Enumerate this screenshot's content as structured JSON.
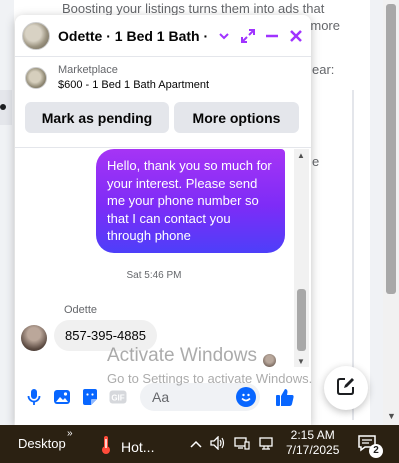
{
  "background": {
    "line1": "Boosting your listings turns them into ads that",
    "line2": "more",
    "edge_right_1": "ear:",
    "edge_right_2": "e"
  },
  "chat": {
    "title": "Odette · 1 Bed 1 Bath ·",
    "marketplace_label": "Marketplace",
    "listing": "$600 - 1 Bed 1 Bath Apartment",
    "mark_pending_label": "Mark as pending",
    "more_options_label": "More options",
    "outgoing_message": "Hello, thank you so much for your interest. Please send me your phone number so that I can contact you through phone",
    "timestamp": "Sat 5:46 PM",
    "sender_name": "Odette",
    "incoming_message": "857-395-4885",
    "composer_placeholder": "Aa"
  },
  "watermark": {
    "line1": "Activate Windows",
    "line2": "Go to Settings to activate Windows."
  },
  "taskbar": {
    "desktop_label": "Desktop",
    "weather_label": "Hot...",
    "time": "2:15 AM",
    "date": "7/17/2025",
    "notification_count": "2"
  },
  "colors": {
    "accent": "#a033ff",
    "bubble_gradient_start": "#a634f5",
    "bubble_gradient_end": "#4d3ff9",
    "messenger_blue": "#0866ff",
    "taskbar_bg": "#2b2112"
  },
  "icons": [
    "chevron-down-icon",
    "expand-icon",
    "minimize-icon",
    "close-icon",
    "microphone-icon",
    "photo-icon",
    "sticker-icon",
    "gif-icon",
    "emoji-icon",
    "thumbs-up-icon",
    "compose-icon",
    "thermometer-icon",
    "chevron-up-icon",
    "speaker-icon",
    "network-icon",
    "keyboard-icon",
    "notification-icon"
  ]
}
